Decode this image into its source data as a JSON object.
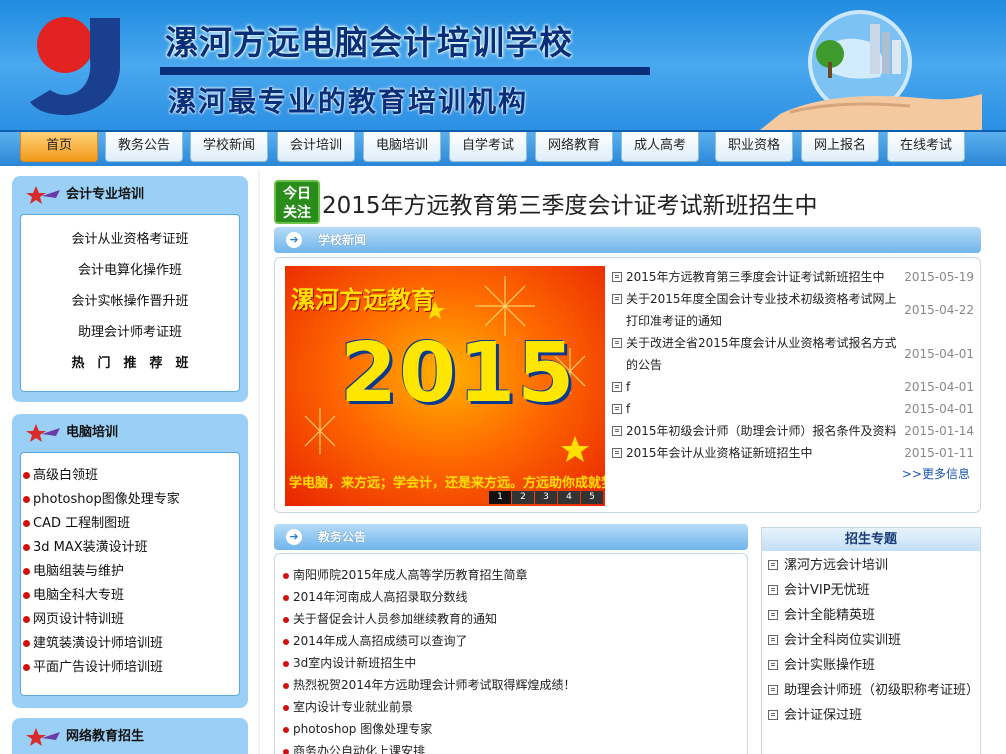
{
  "banner": {
    "title": "漯河方远电脑会计培训学校",
    "slogan": "漯河最专业的教育培训机构"
  },
  "nav": [
    "首页",
    "教务公告",
    "学校新闻",
    "会计培训",
    "电脑培训",
    "自学考试",
    "网络教育",
    "成人高考",
    "职业资格",
    "网上报名",
    "在线考试"
  ],
  "sidebar": {
    "accounting": {
      "title": "会计专业培训",
      "items": [
        "会计从业资格考证班",
        "会计电算化操作班",
        "会计实帐操作晋升班",
        "助理会计师考证班",
        "热　门　推　荐　班"
      ]
    },
    "computer": {
      "title": "电脑培训",
      "items": [
        "高级白领班",
        "photoshop图像处理专家",
        "CAD 工程制图班",
        "3d MAX装潢设计班",
        "电脑组装与维护",
        "电脑全科大专班",
        "网页设计特训班",
        "建筑装潢设计师培训班",
        "平面广告设计师培训班"
      ]
    },
    "online": {
      "title": "网络教育招生"
    }
  },
  "headline": {
    "badge_line1": "今日",
    "badge_line2": "关注",
    "text": "2015年方远教育第三季度会计证考试新班招生中"
  },
  "school_news": {
    "title": "学校新闻",
    "slide": {
      "caption_top": "漯河方远教育",
      "year": "2015",
      "caption_bottom": "学电脑，来方远；学会计，还是来方远。方远助你成就梦想！",
      "pages": [
        "1",
        "2",
        "3",
        "4",
        "5"
      ]
    },
    "items": [
      {
        "text": "2015年方远教育第三季度会计证考试新班招生中",
        "date": "2015-05-19"
      },
      {
        "text": "关于2015年度全国会计专业技术初级资格考试网上打印准考证的通知",
        "date": "2015-04-22"
      },
      {
        "text": "关于改进全省2015年度会计从业资格考试报名方式的公告",
        "date": "2015-04-01"
      },
      {
        "text": "f",
        "date": "2015-04-01"
      },
      {
        "text": "f",
        "date": "2015-04-01"
      },
      {
        "text": "2015年初级会计师（助理会计师）报名条件及资料",
        "date": "2015-01-14"
      },
      {
        "text": "2015年会计从业资格证新班招生中",
        "date": "2015-01-11"
      }
    ],
    "more": ">>更多信息"
  },
  "notices": {
    "title": "教务公告",
    "items": [
      "南阳师院2015年成人高等学历教育招生简章",
      "2014年河南成人高招录取分数线",
      "关于督促会计人员参加继续教育的通知",
      "2014年成人高招成绩可以查询了",
      "3d室内设计新班招生中",
      "热烈祝贺2014年方远助理会计师考试取得辉煌成绩！",
      "室内设计专业就业前景",
      "photoshop 图像处理专家",
      "商务办公自动化上课安排"
    ]
  },
  "special": {
    "title": "招生专题",
    "items": [
      "漯河方远会计培训",
      "会计VIP无忧班",
      "会计全能精英班",
      "会计全科岗位实训班",
      "会计实账操作班",
      "助理会计师班（初级职称考证班）",
      "会计证保过班"
    ]
  },
  "colors": {
    "accent": "#2a86d6",
    "active_tab": "#f29a18",
    "sidebar_bg": "#9bd0f6",
    "dot": "#d21010"
  }
}
